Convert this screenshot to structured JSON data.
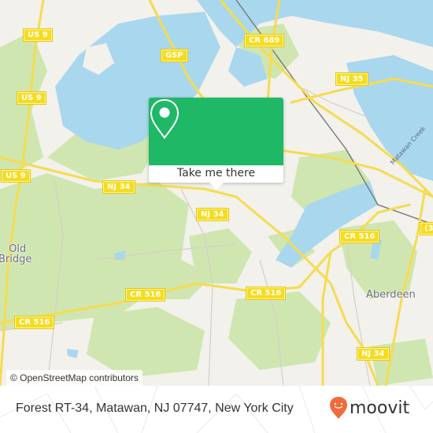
{
  "map": {
    "colors": {
      "land": "#f2f1ec",
      "water": "#a9d7ee",
      "forest": "#cfe6b0",
      "road_major": "#f5dc4f",
      "road_minor": "#d4d0c8",
      "rail": "#777777"
    },
    "road_shields": [
      {
        "label": "US 9"
      },
      {
        "label": "US 9"
      },
      {
        "label": "US 9"
      },
      {
        "label": "GSP"
      },
      {
        "label": "CR 689"
      },
      {
        "label": "NJ 35"
      },
      {
        "label": "NJ 34"
      },
      {
        "label": "NJ 34"
      },
      {
        "label": "CR 516"
      },
      {
        "label": "CR 516"
      },
      {
        "label": "CR 516"
      },
      {
        "label": "CR 516"
      },
      {
        "label": "NJ 34"
      },
      {
        "label": "(3"
      }
    ],
    "place_labels": {
      "old_bridge_line1": "Old",
      "old_bridge_line2": "Bridge",
      "aberdeen": "Aberdeen",
      "matawan_creek": "Matawan Creek"
    },
    "attribution": "© OpenStreetMap contributors"
  },
  "popup": {
    "icon": "location-pin-icon",
    "button_label": "Take me there",
    "accent_color": "#1fb866"
  },
  "footer": {
    "address": "Forest RT-34, Matawan, NJ 07747, New York City",
    "brand": "moovit",
    "brand_color": "#f26a3a"
  }
}
